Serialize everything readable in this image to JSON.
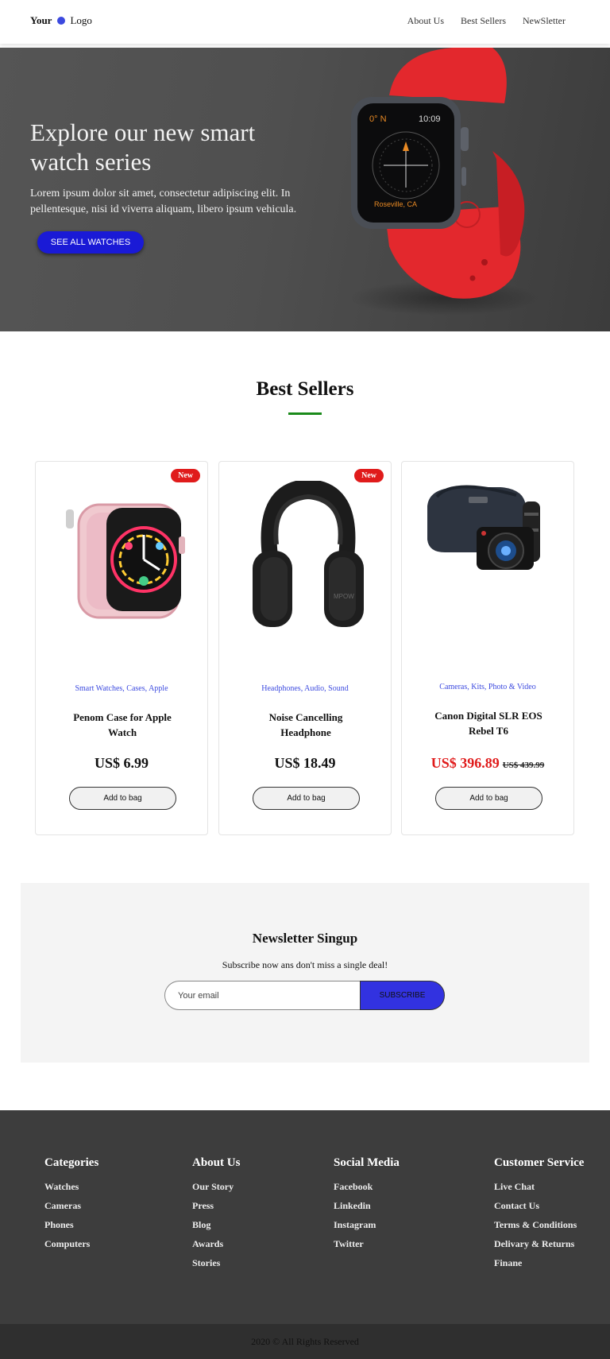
{
  "header": {
    "logo_word1": "Your",
    "logo_word2": "Logo",
    "nav": [
      "About Us",
      "Best Sellers",
      "NewSletter"
    ]
  },
  "hero": {
    "title": "Explore our new smart watch series",
    "text": "Lorem ipsum dolor sit amet, consectetur adipiscing elit. In pellentesque, nisi id viverra aliquam, libero ipsum vehicula.",
    "button": "SEE ALL WATCHES",
    "watch_screen": {
      "heading": "0° N",
      "time": "10:09",
      "location": "Roseville, CA"
    }
  },
  "best_sellers": {
    "title": "Best Sellers",
    "accent_color": "#1a8a1a",
    "products": [
      {
        "badge": "New",
        "categories": "Smart Watches, Cases, Apple",
        "name": "Penom Case for Apple Watch",
        "price": "US$ 6.99",
        "old_price": "",
        "button": "Add to bag",
        "image_icon": "watch-case-icon"
      },
      {
        "badge": "New",
        "categories": "Headphones, Audio, Sound",
        "name": "Noise Cancelling Headphone",
        "price": "US$ 18.49",
        "old_price": "",
        "button": "Add to bag",
        "image_icon": "headphone-icon"
      },
      {
        "badge": "",
        "categories": "Cameras, Kits, Photo & Video",
        "name": "Canon Digital SLR EOS Rebel T6",
        "price": "US$ 396.89",
        "old_price": "US$ 439.99",
        "button": "Add to bag",
        "image_icon": "camera-kit-icon"
      }
    ]
  },
  "newsletter": {
    "title": "Newsletter Singup",
    "subtitle": "Subscribe now ans don't miss a single deal!",
    "placeholder": "Your email",
    "button": "SUBSCRIBE"
  },
  "footer": {
    "columns": [
      {
        "title": "Categories",
        "links": [
          "Watches",
          "Cameras",
          "Phones",
          "Computers"
        ]
      },
      {
        "title": "About Us",
        "links": [
          "Our Story",
          "Press",
          "Blog",
          "Awards",
          "Stories"
        ]
      },
      {
        "title": "Social Media",
        "links": [
          "Facebook",
          "Linkedin",
          "Instagram",
          "Twitter"
        ]
      },
      {
        "title": "Customer Service",
        "links": [
          "Live Chat",
          "Contact Us",
          "Terms & Conditions",
          "Delivary & Returns",
          "Finane"
        ]
      }
    ],
    "copyright": "2020 © All Rights Reserved"
  },
  "colors": {
    "brand_blue": "#3b49df",
    "hero_button": "#1a1ad6",
    "sale_red": "#e01b1b",
    "subscribe_button": "#3232e0"
  }
}
